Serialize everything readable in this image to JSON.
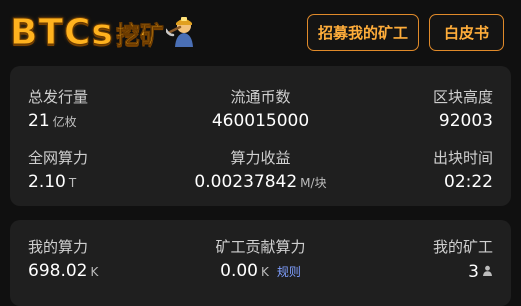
{
  "header": {
    "logo": {
      "latin": "BTCs",
      "chinese": "挖矿"
    },
    "buttons": {
      "recruit": "招募我的矿工",
      "whitepaper": "白皮书"
    }
  },
  "stats": {
    "total_supply": {
      "label": "总发行量",
      "value": "21",
      "unit": "亿枚"
    },
    "circulating": {
      "label": "流通币数",
      "value": "460015000"
    },
    "block_height": {
      "label": "区块高度",
      "value": "92003"
    },
    "network_hashrate": {
      "label": "全网算力",
      "value": "2.10",
      "unit": "T"
    },
    "hashrate_income": {
      "label": "算力收益",
      "value": "0.00237842",
      "unit": "M/块"
    },
    "block_time": {
      "label": "出块时间",
      "value": "02:22"
    }
  },
  "mine": {
    "my_hashrate": {
      "label": "我的算力",
      "value": "698.02",
      "unit": "K"
    },
    "miner_contribution": {
      "label": "矿工贡献算力",
      "value": "0.00",
      "unit": "K",
      "link": "规则"
    },
    "my_miners": {
      "label": "我的矿工",
      "value": "3",
      "icon": "person-icon"
    }
  },
  "colors": {
    "accent": "#ffb21e",
    "button_border": "#e08a2a",
    "card_bg": "#1f1f1f",
    "page_bg": "#101010",
    "link": "#7f9fff"
  }
}
